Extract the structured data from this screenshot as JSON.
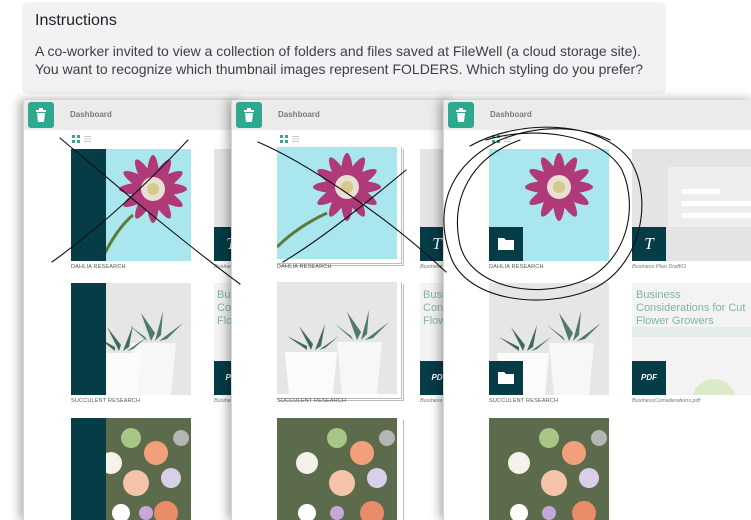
{
  "instructions": {
    "heading": "Instructions",
    "line1": "A co-worker invited to view a collection of folders and files saved at FileWell (a cloud storage site).",
    "line2": "You want to recognize which thumbnail images represent FOLDERS. Which styling do you prefer?"
  },
  "app": {
    "dashboard_label": "Dashboard",
    "logo_icon": "trash-can-icon",
    "accent_color": "#2ea88e",
    "folder_color": "#053c46"
  },
  "items": {
    "dahlia": "DAHLIA RESEARCH",
    "succulent": "SUCCULENT RESEARCH",
    "business_plan_file": "Business Plan Draft01",
    "business_considerations_file": "BusinessConsiderations.pdf",
    "business_short": "Business",
    "doc_preview_title": "Business Considerations for Cut Flower Growers",
    "doc_preview_title_short": "Busi Con Flow",
    "t_badge": "T",
    "pdf_badge": "PDF",
    "pdf_short": "PD"
  },
  "options": [
    {
      "name": "option-teal-band",
      "marked": "crossed out"
    },
    {
      "name": "option-stacked-edges",
      "marked": "crossed out"
    },
    {
      "name": "option-folder-badge",
      "marked": "circled"
    }
  ]
}
